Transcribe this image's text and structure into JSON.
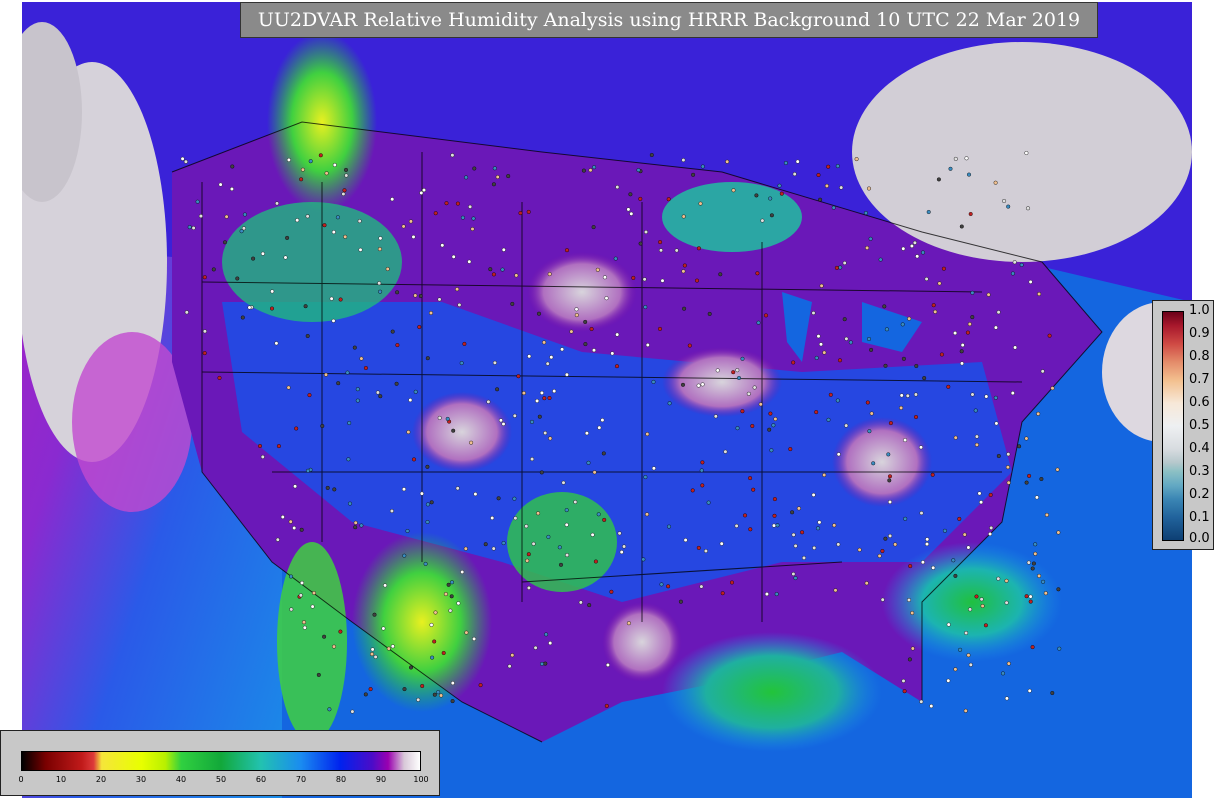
{
  "title": "UU2DVAR Relative Humidity Analysis using HRRR Background 10 UTC 22 Mar 2019",
  "rh_colorbar": {
    "ticks": [
      "0",
      "10",
      "20",
      "30",
      "40",
      "50",
      "60",
      "70",
      "80",
      "90",
      "100"
    ]
  },
  "fraction_colorbar": {
    "ticks": [
      "1.0",
      "0.9",
      "0.8",
      "0.7",
      "0.6",
      "0.5",
      "0.4",
      "0.3",
      "0.2",
      "0.1",
      "0.0"
    ]
  },
  "colors": {
    "ocean_blue": "#1466e0",
    "deep_blue": "#0a28d8",
    "land_purple": "#7a14a8",
    "moist_white": "#e8e4ea",
    "dry_green": "#20c040",
    "very_dry_yellow": "#e8f020",
    "cyan": "#20c8c0"
  }
}
